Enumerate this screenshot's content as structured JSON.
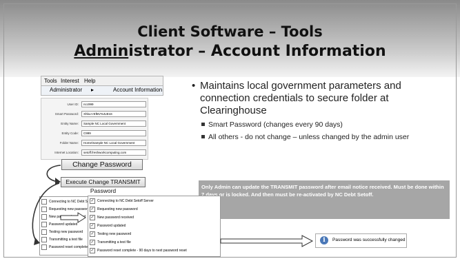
{
  "slide": {
    "title_line1": "Client Software – Tools",
    "title_line2_underlined": "Admin",
    "title_line2_rest": "istrator – Account Information"
  },
  "menubar": {
    "items": [
      "Tools",
      "Interest",
      "Help"
    ]
  },
  "submenu": {
    "item": "Administrator",
    "arrow": "▸",
    "target": "Account Information"
  },
  "form": {
    "fields": [
      {
        "label": "User ID:",
        "value": "ncc999"
      },
      {
        "label": "Smart Password:",
        "value": "Xhbu+rEfBV%4vEsS"
      },
      {
        "label": "Entity Name:",
        "value": "Sample NC Local Government"
      },
      {
        "label": "Entity Code:",
        "value": "C999"
      },
      {
        "label": "Folder Name:",
        "value": "Home\\Sample NC Local Government"
      },
      {
        "label": "Internet Location:",
        "value": "setoff.freshworkcomputing.com"
      }
    ]
  },
  "buttons": {
    "change_password": "Change Password",
    "execute_change": "Execute Change TRANSMIT Password"
  },
  "bullets": {
    "main": "Maintains local government parameters and connection credentials to secure folder at Clearinghouse",
    "sub1": "Smart Password (changes every 90 days)",
    "sub2": "All others - do not change – unless changed by the admin user"
  },
  "note": "Only Admin can update the TRANSMIT password after email notice received.  Must be done within 7 days or is locked. And then must be re-activated by NC Debt Setoff.",
  "checklist_left": [
    "Connecting to NC Debt Setoff Server",
    "Requesting new password",
    "New password received",
    "Password updated",
    "Testing new password",
    "Transmitting a test file",
    "Password reset complete - 90 days to next password reset"
  ],
  "checklist_right": [
    {
      "text": "Connecting to NC Debt Setoff Server",
      "checked": true
    },
    {
      "text": "Requesting new password",
      "checked": true
    },
    {
      "text": "New password received",
      "checked": true
    },
    {
      "text": "Password updated",
      "checked": true
    },
    {
      "text": "Testing new password",
      "checked": true
    },
    {
      "text": "Transmitting a test file",
      "checked": true
    },
    {
      "text": "Password reset complete - 90 days to next password reset",
      "checked": true
    }
  ],
  "message": {
    "icon": "info-icon",
    "text": "Password was successfully changed"
  },
  "colors": {
    "note_bg": "#a6a6a6",
    "info_icon": "#4a78b8"
  }
}
